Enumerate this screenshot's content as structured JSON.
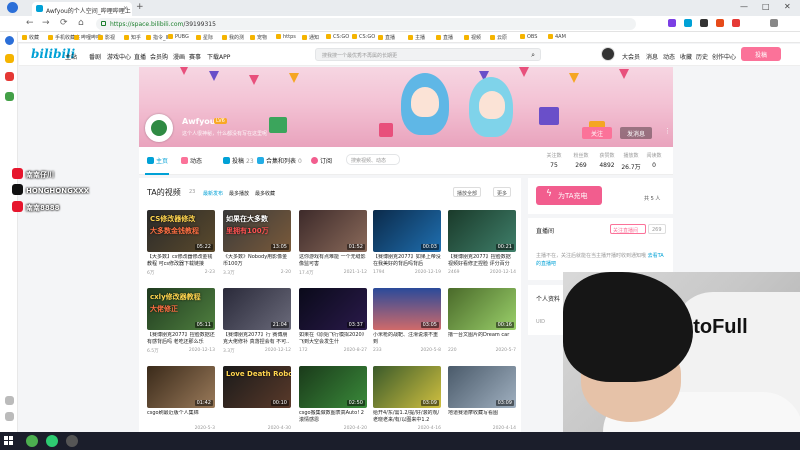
{
  "browser": {
    "tab_title": "Awfyou的个人空间_哔哩哔哩上",
    "tab_close": "×",
    "new_tab": "+",
    "url_host": "https://space.bilibili.com",
    "url_path": "/39199315",
    "window_controls": [
      "—",
      "□",
      "✕"
    ],
    "nav": {
      "back": "←",
      "forward": "→",
      "reload": "⟳",
      "home": "⌂"
    },
    "bookmarks": [
      "收藏",
      "手机收藏夹",
      "哔哩哔哩",
      "影视",
      "知乎",
      "指令_II",
      "PUBG",
      "星际",
      "我的测",
      "宠物",
      "https",
      "通知",
      "CS:GO",
      "CS:GO",
      "直播",
      "主播",
      "直播",
      "视频",
      "云原",
      "OBS",
      "4AM"
    ]
  },
  "bili_header": {
    "logo": "bilibili",
    "nav_items": [
      "主站",
      "番剧",
      "游戏中心",
      "直播",
      "会员购",
      "漫画",
      "赛事",
      "下载APP"
    ],
    "search_placeholder": "搜我搜一个最优秀不再属的长期更",
    "right_items": [
      "大会员",
      "消息",
      "动态",
      "收藏",
      "历史",
      "创作中心"
    ],
    "upload": "投稿"
  },
  "profile": {
    "name": "Awfyou",
    "level": "LV6",
    "sign": "这个人很神秘，什么都没有写在这里呢",
    "follow": "关注",
    "message": "发消息",
    "more": "⋮"
  },
  "space_tabs": [
    {
      "label": "主页",
      "count": "",
      "color": "#00a1d6"
    },
    {
      "label": "动态",
      "count": "",
      "color": "#fb7299"
    },
    {
      "label": "投稿",
      "count": "23",
      "color": "#00a1d6"
    },
    {
      "label": "合集和列表",
      "count": "0",
      "color": "#23ade5"
    },
    {
      "label": "订阅",
      "count": "",
      "color": "#f25d8e"
    }
  ],
  "space_search_placeholder": "搜索视频、动态",
  "stats": [
    {
      "label": "关注数",
      "value": "75"
    },
    {
      "label": "粉丝数",
      "value": "269"
    },
    {
      "label": "获赞数",
      "value": "4892"
    },
    {
      "label": "播放数",
      "value": "26.7万"
    },
    {
      "label": "阅读数",
      "value": "0"
    }
  ],
  "videos_section": {
    "title": "TA的视频",
    "count": "23",
    "sorts": [
      "最新发布",
      "最多播放",
      "最多收藏"
    ],
    "play_all": "播放全部",
    "more": "更多"
  },
  "videos": [
    {
      "title": "【大多数】cs修改器修改金钱教程 可cs修改器下载链接",
      "plays": "6万",
      "date": "2-23",
      "duration": "05:22",
      "thumb_text": "CS修改器修改",
      "thumb_sub": "大多数金钱教程"
    },
    {
      "title": "《大多数》Nobody用影像金币100万",
      "plays": "3.3万",
      "date": "2-20",
      "duration": "13:05",
      "thumb_text": "如果在大多数",
      "thumb_sub": "里拥有100万"
    },
    {
      "title": "这你游戏有点难能 一个无缝影像监可害",
      "plays": "17.4万",
      "date": "2021-1-12",
      "duration": "01:52",
      "thumb_text": "",
      "thumb_sub": ""
    },
    {
      "title": "【赛博朋克2077】如果上帝没在我美好的背后吗背后",
      "plays": "1794",
      "date": "2020-12-19",
      "duration": "00:03",
      "thumb_text": "",
      "thumb_sub": ""
    },
    {
      "title": "【赛博朋克2077】捏脸数据 视频好看修正捏脸 评分百分之…",
      "plays": "2469",
      "date": "2020-12-14",
      "duration": "00:21",
      "thumb_text": "",
      "thumb_sub": ""
    },
    {
      "title": "【赛博朋克2077】捏脸数据还有感背后吗 老吃还那么乐",
      "plays": "6.5万",
      "date": "2020-12-13",
      "duration": "05:11",
      "thumb_text": "cxly修改器教程",
      "thumb_sub": "大佬修正"
    },
    {
      "title": "【赛博朋克2077】行 赛博朋克大佬修补 真落捏会有 不可..",
      "plays": "3.3万",
      "date": "2020-12-12",
      "duration": "21:04",
      "thumb_text": "",
      "thumb_sub": ""
    },
    {
      "title": "如果在《原始飞行模拟2020》飞到大空会发生什",
      "plays": "172",
      "date": "2020-8-27",
      "duration": "03:37",
      "thumb_text": "",
      "thumb_sub": ""
    },
    {
      "title": "小米枪的战靶、注滑说滚不重到",
      "plays": "233",
      "date": "2020-5-8",
      "duration": "03:05",
      "thumb_text": "",
      "thumb_sub": ""
    },
    {
      "title": "撸一台文图片的Dream car",
      "plays": "220",
      "date": "2020-5-7",
      "duration": "00:16",
      "thumb_text": "",
      "thumb_sub": ""
    },
    {
      "title": "csgo刷最近版个人集锦",
      "plays": "",
      "date": "2020-5-3",
      "duration": "01:42",
      "thumb_text": "",
      "thumb_sub": ""
    },
    {
      "title": "",
      "plays": "",
      "date": "2020-4-30",
      "duration": "00:10",
      "thumb_text": "Love Death Robots",
      "thumb_sub": ""
    },
    {
      "title": "csgo搬集做数图表高Auto! 2 滚情感恩",
      "plays": "",
      "date": "2020-4-20",
      "duration": "02:50",
      "thumb_text": "",
      "thumb_sub": ""
    },
    {
      "title": "给开4/东/需1.2/提/好/滚的观/ 老晓老来/有/以图来中1.2",
      "plays": "",
      "date": "2020-4-16",
      "duration": "03:09",
      "thumb_text": "",
      "thumb_sub": ""
    },
    {
      "title": "地道赛道摩收藏写看图",
      "plays": "",
      "date": "2020-4-14",
      "duration": "03:09",
      "thumb_text": "",
      "thumb_sub": ""
    }
  ],
  "right_panel": {
    "charge_label": "为TA充电",
    "charge_count": "共 5 人",
    "live_title": "直播间",
    "live_badge": "关注直播间",
    "live_count": "269",
    "live_desc": "主播不在，关注后就能在当主播开播时收到通知哦",
    "live_link": "去看TA的直播吧",
    "info_title": "个人资料",
    "uid_label": "UID"
  },
  "overlay": {
    "socials": [
      {
        "name": "weibo-icon",
        "text": "南南仔川",
        "color": "#e6162d"
      },
      {
        "name": "tiktok-icon",
        "text": "HONGHONGXXX",
        "color": "#111111"
      },
      {
        "name": "weibo2-icon",
        "text": "南南8888",
        "color": "#e6162d"
      }
    ],
    "webcam_logo": "otoFull"
  },
  "taskbar": {
    "clock": ""
  }
}
